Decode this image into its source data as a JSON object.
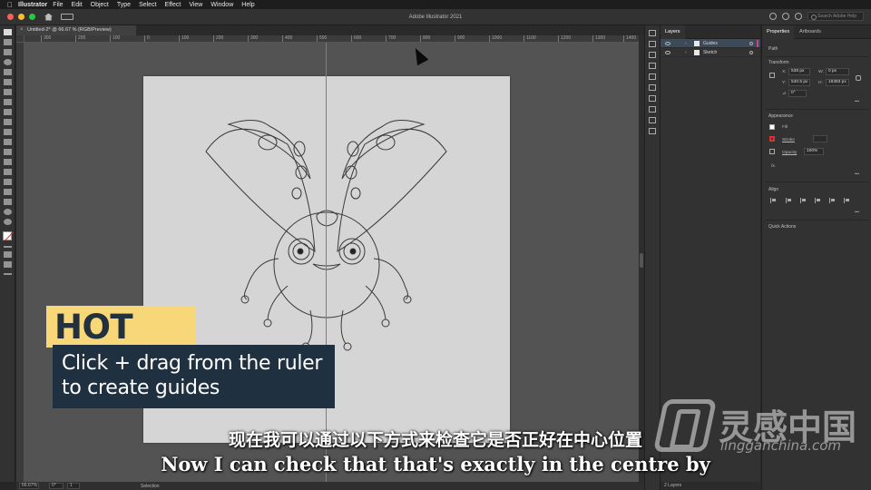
{
  "menubar": {
    "app": "Illustrator",
    "items": [
      "File",
      "Edit",
      "Object",
      "Type",
      "Select",
      "Effect",
      "View",
      "Window",
      "Help"
    ]
  },
  "appbar": {
    "title": "Adobe Illustrator 2021",
    "search_placeholder": "Search Adobe Help"
  },
  "document": {
    "tab_title": "Untitled-2* @ 66.67 % (RGB/Preview)"
  },
  "ruler": {
    "ticks": [
      "300",
      "200",
      "100",
      "0",
      "100",
      "200",
      "300",
      "400",
      "500",
      "600",
      "700",
      "800",
      "900",
      "1000",
      "1100",
      "1200",
      "1300",
      "1400"
    ]
  },
  "layers_panel": {
    "tab": "Layers",
    "layers": [
      {
        "name": "Guides",
        "color": "#c8458c"
      },
      {
        "name": "Sketch",
        "color": "#4a78d8"
      }
    ],
    "footer": "2 Layers"
  },
  "properties_panel": {
    "tabs": [
      "Properties",
      "Artboards"
    ],
    "object_type": "Path",
    "transform_title": "Transform",
    "x_label": "X:",
    "x_value": "538 px",
    "y_label": "Y:",
    "y_value": "540.5 px",
    "w_label": "W:",
    "w_value": "0 px",
    "h_label": "H:",
    "h_value": "16383 px",
    "rotate_value": "0°",
    "appearance_title": "Appearance",
    "fill_label": "Fill",
    "stroke_label": "Stroke",
    "opacity_label": "Opacity",
    "opacity_value": "100%",
    "fx_label": "fx.",
    "align_title": "Align",
    "quick_actions_title": "Quick Actions"
  },
  "statusbar": {
    "zoom": "66.67%",
    "rotation": "0°",
    "page": "1",
    "tool": "Selection"
  },
  "overlay": {
    "hot_tip": "HOT TIP",
    "tip_line1": "Click + drag from the ruler",
    "tip_line2": "to create guides",
    "subtitle_cn": "现在我可以通过以下方式来检查它是否正好在中心位置",
    "subtitle_en": "Now I can check that that's exactly in the centre by",
    "watermark_main": "灵感中国",
    "watermark_sub": "lingganchina.com"
  },
  "colors": {
    "guide": "#e0506a",
    "tip_yellow": "#f7d778",
    "tip_navy": "#1f3040"
  }
}
